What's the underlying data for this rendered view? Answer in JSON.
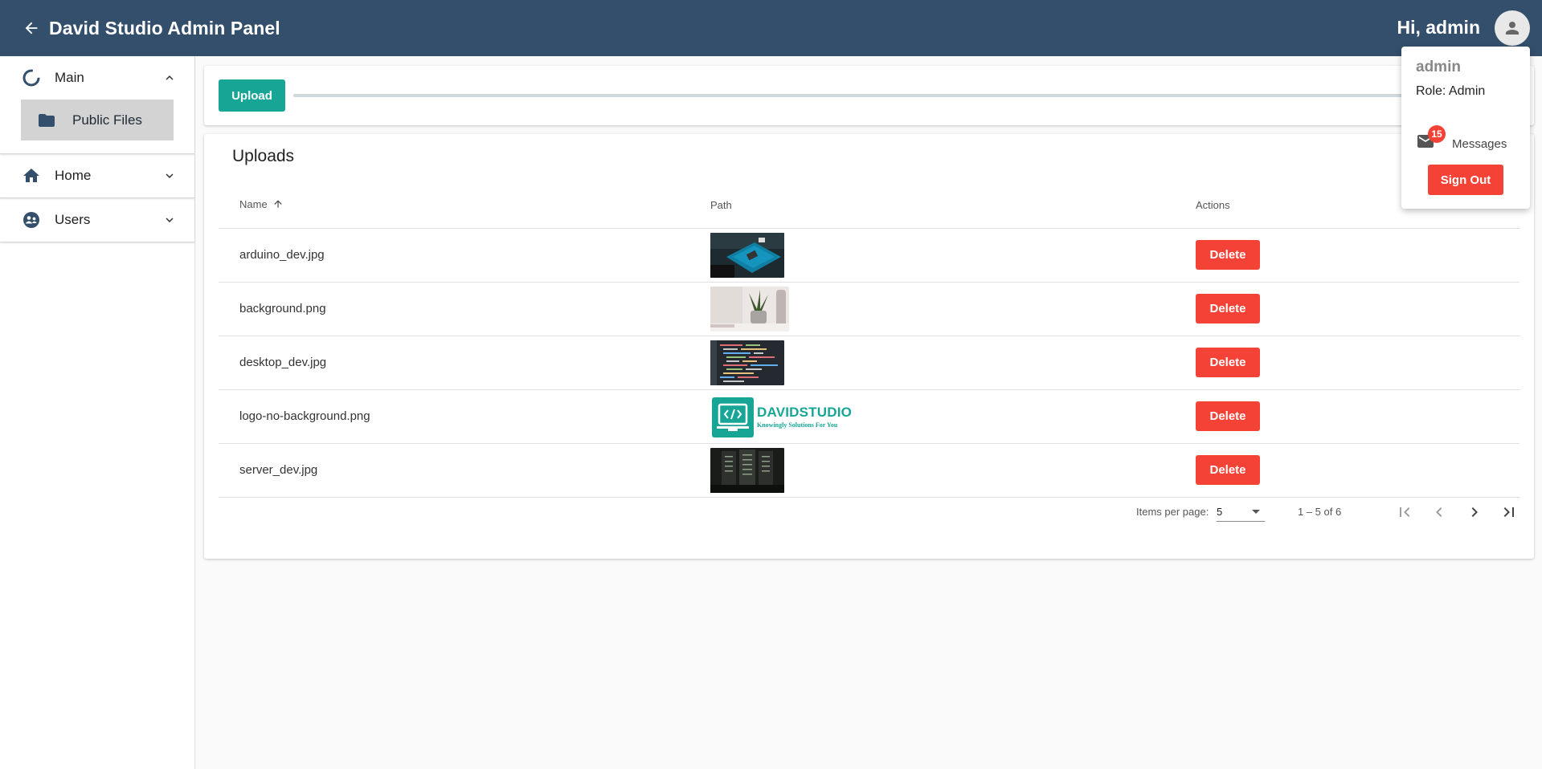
{
  "topbar": {
    "title": "David Studio Admin Panel",
    "greeting": "Hi, admin",
    "back_icon": "arrow-left-icon",
    "avatar_icon": "person-icon",
    "background": "#344f6b"
  },
  "sidebar": {
    "groups": [
      {
        "label": "Main",
        "icon": "spinner-icon",
        "expanded": true,
        "children": [
          {
            "label": "Public Files",
            "icon": "folder-icon",
            "selected": true
          }
        ]
      },
      {
        "label": "Home",
        "icon": "home-icon",
        "expanded": false
      },
      {
        "label": "Users",
        "icon": "users-icon",
        "expanded": false
      }
    ]
  },
  "upload": {
    "button_label": "Upload",
    "progress": 0,
    "accent": "#17a596"
  },
  "uploads": {
    "title": "Uploads",
    "columns": {
      "name": "Name",
      "path": "Path",
      "actions": "Actions"
    },
    "sort": {
      "column": "name",
      "direction": "ascending"
    },
    "rows": [
      {
        "name": "arduino_dev.jpg",
        "thumbnail": "arduino-board-image",
        "action_label": "Delete"
      },
      {
        "name": "background.png",
        "thumbnail": "plant-desk-image",
        "action_label": "Delete"
      },
      {
        "name": "desktop_dev.jpg",
        "thumbnail": "code-screen-image",
        "action_label": "Delete"
      },
      {
        "name": "logo-no-background.png",
        "thumbnail": "davidstudio-logo-image",
        "action_label": "Delete",
        "logo_title_1": "DAVID",
        "logo_title_2": "STUDIO",
        "logo_tagline": "Knowingly Solutions For You"
      },
      {
        "name": "server_dev.jpg",
        "thumbnail": "server-room-image",
        "action_label": "Delete"
      }
    ],
    "paginator": {
      "items_per_page_label": "Items per page:",
      "page_size": "5",
      "range_label": "1 – 5 of 6"
    },
    "danger": "#f44336"
  },
  "user_menu": {
    "name": "admin",
    "role": "Role: Admin",
    "messages_label": "Messages",
    "messages_count": "15",
    "sign_out_label": "Sign Out"
  }
}
